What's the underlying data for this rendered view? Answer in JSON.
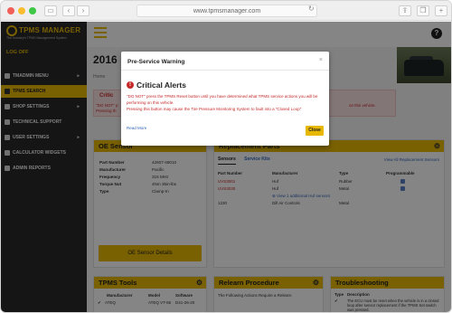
{
  "browser": {
    "url": "www.tpmsmanager.com"
  },
  "sidebar": {
    "logo_title": "TPMS MANAGER",
    "logo_subtitle": "The Industry's TPMS Management System",
    "logoff": "LOG OFF",
    "items": [
      {
        "label": "TMADMIN MENU",
        "caret": "▸",
        "active": false
      },
      {
        "label": "TPMS SEARCH",
        "caret": "",
        "active": true
      },
      {
        "label": "SHOP SETTINGS",
        "caret": "▸",
        "active": false
      },
      {
        "label": "TECHNICAL SUPPORT",
        "caret": "",
        "active": false
      },
      {
        "label": "USER SETTINGS",
        "caret": "▸",
        "active": false
      },
      {
        "label": "CALCULATOR WIDGETS",
        "caret": "",
        "active": false
      },
      {
        "label": "ADMIN REPORTS",
        "caret": "",
        "active": false
      }
    ]
  },
  "page": {
    "title": "2016",
    "breadcrumb": "Home",
    "alert_title": "Critic",
    "alert_body_left": "\"DO NOT\" p",
    "alert_body_left2": "Pressing th",
    "alert_body_right": "on this vehicle."
  },
  "oe_sensor": {
    "title": "OE Sensor",
    "rows": [
      {
        "label": "Part Number",
        "value": "42607-48010"
      },
      {
        "label": "Manufacturer",
        "value": "Pacific"
      },
      {
        "label": "Frequency",
        "value": "315 MHz"
      },
      {
        "label": "Torque Nut",
        "value": "4Nm 35in-lbs"
      },
      {
        "label": "Type",
        "value": "Clamp-In"
      }
    ],
    "button": "OE Sensor Details"
  },
  "replacement": {
    "title": "Replacement Parts",
    "tabs": [
      "Sensors",
      "Service Kits"
    ],
    "view_all": "View All Replacement Sensors",
    "headers": [
      "Part Number",
      "Manufacturer",
      "Type",
      "Programmable"
    ],
    "rows": [
      {
        "part": "UVS3001",
        "mfr": "Huf",
        "type": "Rubber"
      },
      {
        "part": "UVS3030",
        "mfr": "Huf",
        "type": "Metal"
      },
      {
        "part": "1230",
        "mfr": "Dill Air Controls",
        "type": "Metal"
      }
    ],
    "additional": "View 1 additional Huf sensors"
  },
  "tpms_tools": {
    "title": "TPMS Tools",
    "headers": [
      "Manufacturer",
      "Model",
      "Software"
    ],
    "row": {
      "mfr": "ATEQ",
      "model": "ATEQ VT-56",
      "software": "D41-26-20"
    }
  },
  "relearn": {
    "title": "Relearn Procedure",
    "intro": "The Following Actions Require a Relearn",
    "rows": [
      {
        "label": "Add Air",
        "value": "Yes"
      },
      {
        "label": "Rotate Tires",
        "value": "Yes"
      },
      {
        "label": "Replace Sensor",
        "value": "Yes"
      }
    ]
  },
  "troubleshooting": {
    "title": "Troubleshooting",
    "headers": [
      "Type",
      "Description"
    ],
    "items": [
      "The ECU must be reset when the vehicle is in a closed loop after sensor replacement if the TPMS Set switch was pressed.",
      "Toyota/Lexus Tire Pressure Warning Select Switch Help Tool"
    ]
  },
  "modal": {
    "title": "Pre-Service Warning",
    "close": "×",
    "heading": "Critical Alerts",
    "body_line1": "\"DO NOT\" press the TPMS Reset button until you have determined what TPMS service actions you will be performing on this vehicle.",
    "body_line2": "Pressing this button may cause the Tire Pressure Monitoring System to fault into a \"Closed Loop\"",
    "link": "Read More",
    "button": "Close"
  }
}
